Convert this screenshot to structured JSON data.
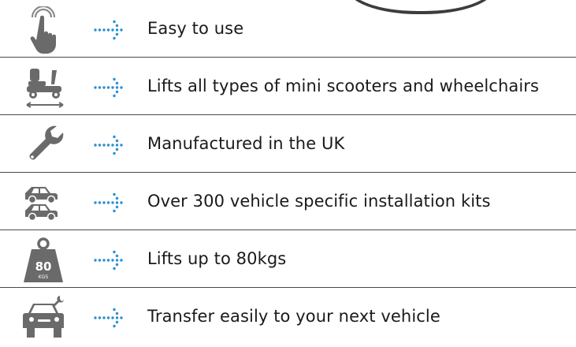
{
  "features": [
    {
      "icon": "touch-hand-icon",
      "label": "Easy to use"
    },
    {
      "icon": "mobility-scooter-icon",
      "label": "Lifts all types of mini scooters and wheelchairs"
    },
    {
      "icon": "wrench-icon",
      "label": "Manufactured in the UK"
    },
    {
      "icon": "two-cars-icon",
      "label": "Over 300 vehicle specific installation kits"
    },
    {
      "icon": "weight-icon",
      "label": "Lifts up to 80kgs",
      "badge_number": "80",
      "badge_unit": "KGS"
    },
    {
      "icon": "car-with-wrench-icon",
      "label": "Transfer easily to your next vehicle"
    }
  ],
  "colors": {
    "icon": "#6a6a6a",
    "arrow": "#2a8fd6",
    "text": "#1a1a1a",
    "divider": "#4a4a4a"
  }
}
